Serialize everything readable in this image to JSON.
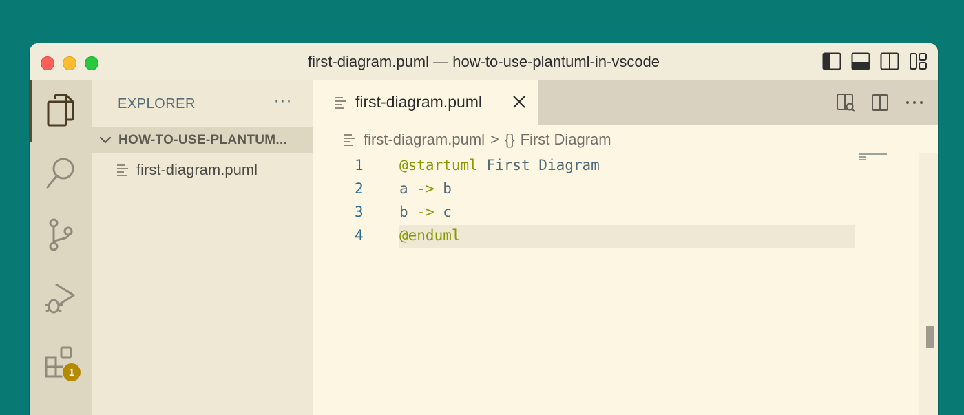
{
  "window": {
    "title": "first-diagram.puml — how-to-use-plantuml-in-vscode"
  },
  "activity_bar": {
    "items": [
      "explorer-icon",
      "search-icon",
      "source-control-icon",
      "run-debug-icon",
      "extensions-icon"
    ],
    "extensions_badge": "1"
  },
  "sidebar": {
    "title": "EXPLORER",
    "more": "···",
    "folder_name": "HOW-TO-USE-PLANTUM...",
    "files": [
      {
        "name": "first-diagram.puml"
      }
    ]
  },
  "tabs": [
    {
      "label": "first-diagram.puml",
      "active": true
    }
  ],
  "breadcrumb": {
    "file": "first-diagram.puml",
    "separator": ">",
    "symbol_icon": "{}",
    "symbol": "First Diagram"
  },
  "editor": {
    "lines": [
      {
        "num": "1",
        "kw": "@startuml",
        "rest": " First Diagram"
      },
      {
        "num": "2",
        "a": "a",
        "op": "->",
        "b": "b"
      },
      {
        "num": "3",
        "a": "b",
        "op": "->",
        "b": "c"
      },
      {
        "num": "4",
        "kw": "@enduml"
      }
    ]
  },
  "colors": {
    "accent_badge": "#b58900",
    "keyword": "#859900",
    "background": "#fdf6e3"
  }
}
